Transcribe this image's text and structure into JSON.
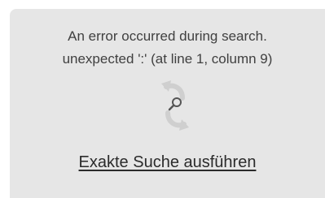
{
  "error": {
    "line1": "An error occurred during search.",
    "line2": "unexpected ':' (at line 1, column 9)"
  },
  "icon": "refresh-search-icon",
  "action": {
    "label": "Exakte Suche ausführen"
  },
  "colors": {
    "panel_bg": "#e6e6e6",
    "text": "#404040",
    "icon": "#c4c4c4"
  }
}
